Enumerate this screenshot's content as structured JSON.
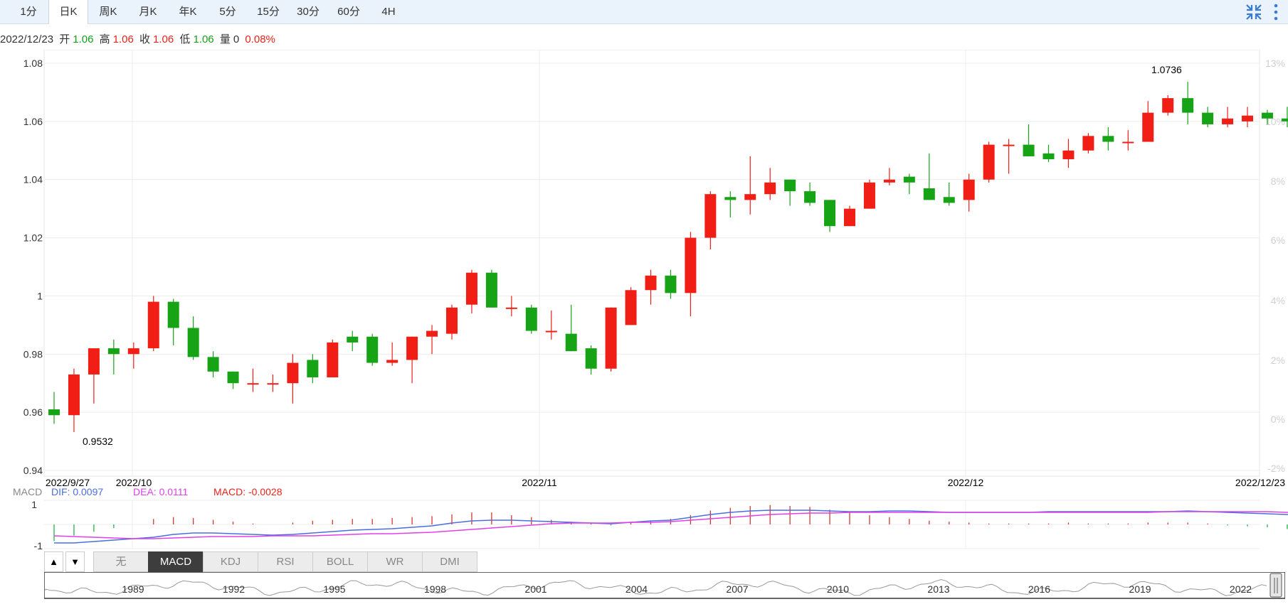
{
  "tabs": [
    "1分",
    "日K",
    "周K",
    "月K",
    "年K",
    "5分",
    "15分",
    "30分",
    "60分",
    "4H"
  ],
  "active_tab": "日K",
  "toolbar_icons": [
    "collapse-icon",
    "more-vertical-icon"
  ],
  "info": {
    "date": "2022/12/23",
    "open_label": "开",
    "open": "1.06",
    "high_label": "高",
    "high": "1.06",
    "close_label": "收",
    "close": "1.06",
    "low_label": "低",
    "low": "1.06",
    "volume_label": "量",
    "volume": "0",
    "change": "0.08%"
  },
  "colors": {
    "up": "#f01e14",
    "down": "#16a316",
    "dif": "#4a6ee0",
    "dea": "#e040e8",
    "macd_label": "#e8231a",
    "tab_bar": "#eaf2fb"
  },
  "chart_data": {
    "type": "candlestick",
    "y_ticks": [
      "1.08",
      "1.06",
      "1.04",
      "1.02",
      "1",
      "0.98",
      "0.96",
      "0.94"
    ],
    "y_range": [
      0.94,
      1.08
    ],
    "right_ticks": [
      "13%",
      "10%",
      "8%",
      "6%",
      "4%",
      "2%",
      "0%",
      "-2%"
    ],
    "x_labels": [
      "2022/9/27",
      "2022/10",
      "2022/11",
      "2022/12",
      "2022/12/23"
    ],
    "max_label": "1.0736",
    "min_label": "0.9532",
    "candles": [
      {
        "o": 0.961,
        "c": 0.959,
        "h": 0.967,
        "l": 0.956
      },
      {
        "o": 0.959,
        "c": 0.973,
        "h": 0.975,
        "l": 0.9532
      },
      {
        "o": 0.973,
        "c": 0.982,
        "h": 0.982,
        "l": 0.963
      },
      {
        "o": 0.982,
        "c": 0.98,
        "h": 0.985,
        "l": 0.973
      },
      {
        "o": 0.98,
        "c": 0.982,
        "h": 0.984,
        "l": 0.975
      },
      {
        "o": 0.982,
        "c": 0.998,
        "h": 1.0,
        "l": 0.981
      },
      {
        "o": 0.998,
        "c": 0.989,
        "h": 0.999,
        "l": 0.983
      },
      {
        "o": 0.989,
        "c": 0.979,
        "h": 0.993,
        "l": 0.978
      },
      {
        "o": 0.979,
        "c": 0.974,
        "h": 0.981,
        "l": 0.972
      },
      {
        "o": 0.974,
        "c": 0.97,
        "h": 0.974,
        "l": 0.968
      },
      {
        "o": 0.97,
        "c": 0.97,
        "h": 0.975,
        "l": 0.967
      },
      {
        "o": 0.97,
        "c": 0.97,
        "h": 0.973,
        "l": 0.967
      },
      {
        "o": 0.97,
        "c": 0.977,
        "h": 0.98,
        "l": 0.963
      },
      {
        "o": 0.978,
        "c": 0.972,
        "h": 0.98,
        "l": 0.97
      },
      {
        "o": 0.972,
        "c": 0.984,
        "h": 0.985,
        "l": 0.972
      },
      {
        "o": 0.986,
        "c": 0.984,
        "h": 0.988,
        "l": 0.981
      },
      {
        "o": 0.986,
        "c": 0.977,
        "h": 0.987,
        "l": 0.976
      },
      {
        "o": 0.977,
        "c": 0.978,
        "h": 0.984,
        "l": 0.976
      },
      {
        "o": 0.978,
        "c": 0.986,
        "h": 0.986,
        "l": 0.97
      },
      {
        "o": 0.986,
        "c": 0.988,
        "h": 0.99,
        "l": 0.98
      },
      {
        "o": 0.987,
        "c": 0.996,
        "h": 0.997,
        "l": 0.985
      },
      {
        "o": 0.997,
        "c": 1.008,
        "h": 1.009,
        "l": 0.994
      },
      {
        "o": 1.008,
        "c": 0.996,
        "h": 1.009,
        "l": 0.996
      },
      {
        "o": 0.996,
        "c": 0.996,
        "h": 1.0,
        "l": 0.993
      },
      {
        "o": 0.996,
        "c": 0.988,
        "h": 0.997,
        "l": 0.987
      },
      {
        "o": 0.988,
        "c": 0.988,
        "h": 0.995,
        "l": 0.985
      },
      {
        "o": 0.987,
        "c": 0.981,
        "h": 0.997,
        "l": 0.981
      },
      {
        "o": 0.982,
        "c": 0.975,
        "h": 0.983,
        "l": 0.973
      },
      {
        "o": 0.975,
        "c": 0.996,
        "h": 0.996,
        "l": 0.974
      },
      {
        "o": 0.99,
        "c": 1.002,
        "h": 1.003,
        "l": 0.99
      },
      {
        "o": 1.002,
        "c": 1.007,
        "h": 1.009,
        "l": 0.997
      },
      {
        "o": 1.007,
        "c": 1.001,
        "h": 1.009,
        "l": 0.999
      },
      {
        "o": 1.001,
        "c": 1.02,
        "h": 1.022,
        "l": 0.993
      },
      {
        "o": 1.02,
        "c": 1.035,
        "h": 1.036,
        "l": 1.016
      },
      {
        "o": 1.034,
        "c": 1.033,
        "h": 1.036,
        "l": 1.027
      },
      {
        "o": 1.033,
        "c": 1.035,
        "h": 1.048,
        "l": 1.028
      },
      {
        "o": 1.035,
        "c": 1.039,
        "h": 1.044,
        "l": 1.033
      },
      {
        "o": 1.04,
        "c": 1.036,
        "h": 1.04,
        "l": 1.031
      },
      {
        "o": 1.036,
        "c": 1.032,
        "h": 1.039,
        "l": 1.031
      },
      {
        "o": 1.033,
        "c": 1.024,
        "h": 1.033,
        "l": 1.022
      },
      {
        "o": 1.024,
        "c": 1.03,
        "h": 1.031,
        "l": 1.024
      },
      {
        "o": 1.03,
        "c": 1.039,
        "h": 1.04,
        "l": 1.03
      },
      {
        "o": 1.039,
        "c": 1.04,
        "h": 1.044,
        "l": 1.038
      },
      {
        "o": 1.041,
        "c": 1.039,
        "h": 1.042,
        "l": 1.035
      },
      {
        "o": 1.037,
        "c": 1.033,
        "h": 1.049,
        "l": 1.033
      },
      {
        "o": 1.034,
        "c": 1.032,
        "h": 1.039,
        "l": 1.031
      },
      {
        "o": 1.033,
        "c": 1.04,
        "h": 1.042,
        "l": 1.029
      },
      {
        "o": 1.04,
        "c": 1.052,
        "h": 1.053,
        "l": 1.039
      },
      {
        "o": 1.052,
        "c": 1.052,
        "h": 1.054,
        "l": 1.042
      },
      {
        "o": 1.052,
        "c": 1.048,
        "h": 1.059,
        "l": 1.048
      },
      {
        "o": 1.049,
        "c": 1.047,
        "h": 1.052,
        "l": 1.046
      },
      {
        "o": 1.047,
        "c": 1.05,
        "h": 1.054,
        "l": 1.044
      },
      {
        "o": 1.05,
        "c": 1.055,
        "h": 1.056,
        "l": 1.049
      },
      {
        "o": 1.055,
        "c": 1.053,
        "h": 1.058,
        "l": 1.05
      },
      {
        "o": 1.053,
        "c": 1.053,
        "h": 1.057,
        "l": 1.05
      },
      {
        "o": 1.053,
        "c": 1.063,
        "h": 1.067,
        "l": 1.053
      },
      {
        "o": 1.063,
        "c": 1.068,
        "h": 1.069,
        "l": 1.062
      },
      {
        "o": 1.068,
        "c": 1.063,
        "h": 1.0736,
        "l": 1.059
      },
      {
        "o": 1.063,
        "c": 1.059,
        "h": 1.065,
        "l": 1.058
      },
      {
        "o": 1.059,
        "c": 1.061,
        "h": 1.065,
        "l": 1.058
      },
      {
        "o": 1.06,
        "c": 1.062,
        "h": 1.065,
        "l": 1.058
      },
      {
        "o": 1.063,
        "c": 1.061,
        "h": 1.064,
        "l": 1.059
      },
      {
        "o": 1.061,
        "c": 1.06,
        "h": 1.065,
        "l": 1.058
      },
      {
        "o": 1.06,
        "c": 1.061,
        "h": 1.062,
        "l": 1.059
      }
    ]
  },
  "macd": {
    "title": "MACD",
    "dif_text": "DIF: 0.0097",
    "dea_text": "DEA: 0.0111",
    "macd_text": "MACD: -0.0028",
    "y_ticks": [
      "1",
      "-1"
    ]
  },
  "indicator_tabs": [
    "无",
    "MACD",
    "KDJ",
    "RSI",
    "BOLL",
    "WR",
    "DMI"
  ],
  "active_indicator": "MACD",
  "arrows": [
    "▲",
    "▼"
  ],
  "overview_years": [
    "1989",
    "1992",
    "1995",
    "1998",
    "2001",
    "2004",
    "2007",
    "2010",
    "2013",
    "2016",
    "2019",
    "2022"
  ]
}
